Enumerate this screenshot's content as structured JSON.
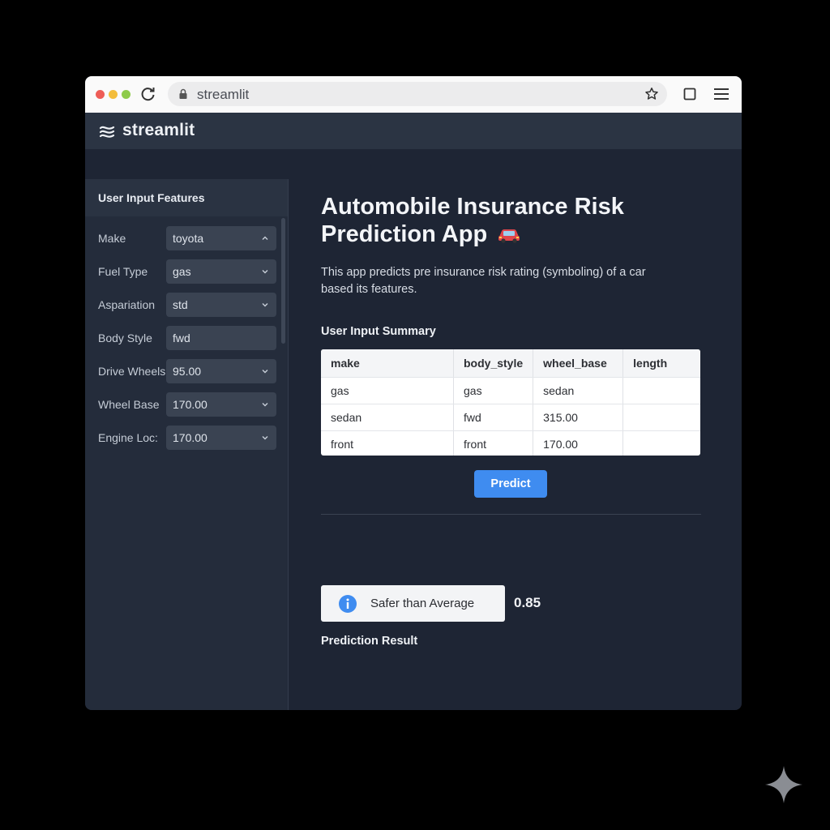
{
  "browser": {
    "url": "streamlit"
  },
  "app": {
    "logo_text": "streamlit"
  },
  "sidebar": {
    "title": "User Input Features",
    "fields": [
      {
        "label": "Make",
        "value": "toyota",
        "caret": "up"
      },
      {
        "label": "Fuel Type",
        "value": "gas",
        "caret": "down"
      },
      {
        "label": "Aspariation",
        "value": "std",
        "caret": "down"
      },
      {
        "label": "Body Style",
        "value": "fwd",
        "caret": "none"
      },
      {
        "label": "Drive Wheels",
        "value": "95.00",
        "caret": "down"
      },
      {
        "label": "Wheel Base",
        "value": "170.00",
        "caret": "down"
      },
      {
        "label": "Engine Loc:",
        "value": "170.00",
        "caret": "down"
      }
    ]
  },
  "main": {
    "title_line1": "Automobile Insurance Risk",
    "title_line2": "Prediction App",
    "description": "This app predicts pre insurance risk rating (symboling) of a car based its features.",
    "summary_heading": "User Input Summary",
    "table": {
      "columns": [
        "make",
        "body_style",
        "wheel_base",
        "length"
      ],
      "rows": [
        [
          "gas",
          "gas",
          "sedan",
          ""
        ],
        [
          "sedan",
          "fwd",
          "315.00",
          ""
        ],
        [
          "front",
          "front",
          "170.00",
          ""
        ]
      ]
    },
    "predict_label": "Predict",
    "result_heading": "Prediction Result",
    "result_text": "Safer than Average",
    "result_score": "0.85"
  },
  "colors": {
    "accent": "#3f8cf0",
    "window_bg": "#1e2534",
    "sidebar_bg": "#242c3b"
  },
  "icons": [
    "reload-icon",
    "lock-icon",
    "star-icon",
    "tab-icon",
    "menu-icon",
    "streamlit-logo-icon",
    "car-icon",
    "info-icon",
    "sparkle-icon"
  ]
}
